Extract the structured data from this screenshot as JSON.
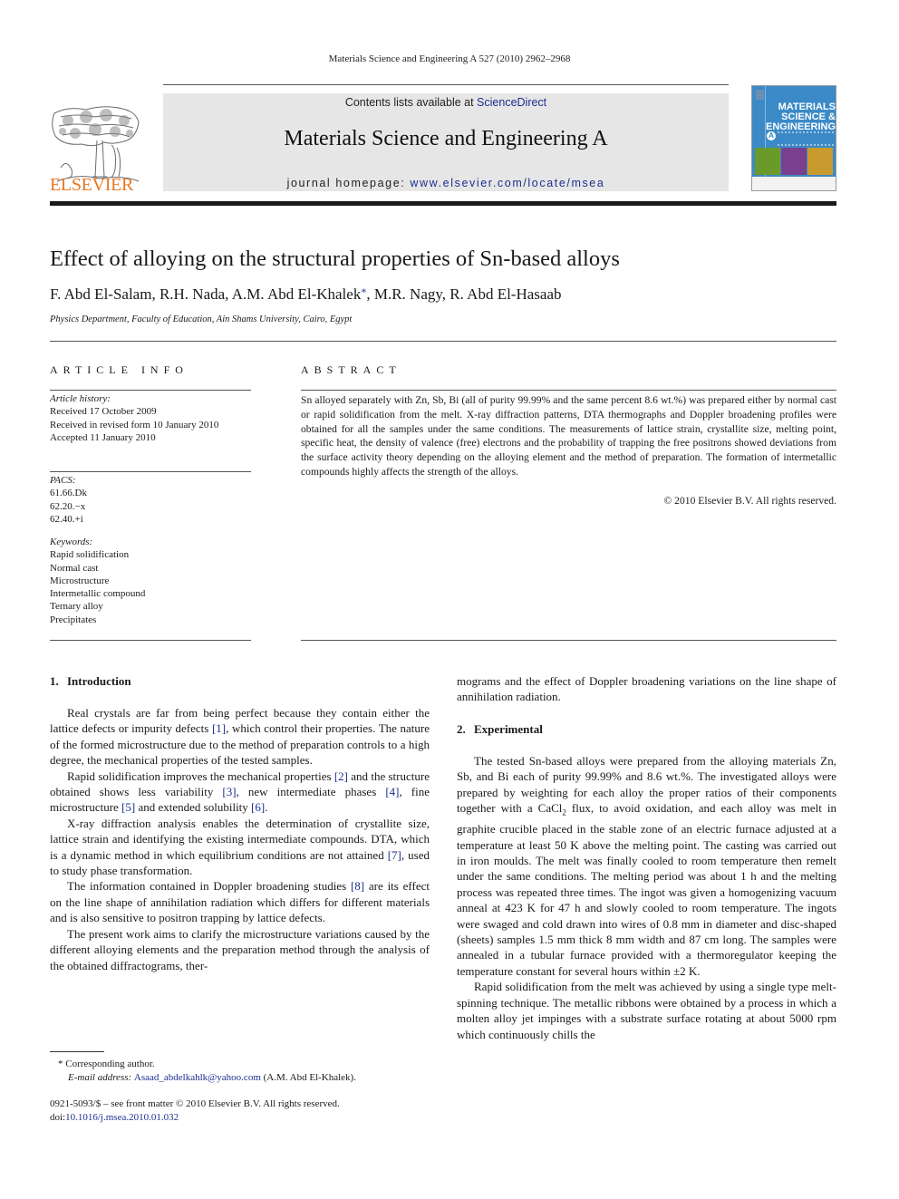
{
  "header": {
    "running_head": "Materials Science and Engineering A 527 (2010) 2962–2968",
    "contents_prefix": "Contents lists available at ",
    "contents_link": "ScienceDirect",
    "journal_name": "Materials Science and Engineering A",
    "homepage_prefix": "journal homepage: ",
    "homepage_link": "www.elsevier.com/locate/msea",
    "publisher_logo_text": "ELSEVIER",
    "cover": {
      "title_lines": [
        "MATERIALS",
        "SCIENCE &",
        "ENGINEERING"
      ],
      "badge": "A"
    },
    "colors": {
      "link": "#1c2f8f",
      "elsevier_orange": "#e87722",
      "cover_blue": "#3b8ac7"
    }
  },
  "article": {
    "title": "Effect of alloying on the structural properties of Sn-based alloys",
    "authors_before_star": "F. Abd El-Salam, R.H. Nada, A.M. Abd El-Khalek",
    "star": "*",
    "authors_after_star": ", M.R. Nagy, R. Abd El-Hasaab",
    "affiliation": "Physics Department, Faculty of Education, Ain Shams University, Cairo, Egypt"
  },
  "article_info": {
    "heading": "ARTICLE INFO",
    "history_label": "Article history:",
    "history": [
      "Received 17 October 2009",
      "Received in revised form 10 January 2010",
      "Accepted 11 January 2010"
    ],
    "pacs_label": "PACS:",
    "pacs": [
      "61.66.Dk",
      "62.20.−x",
      "62.40.+i"
    ],
    "keywords_label": "Keywords:",
    "keywords": [
      "Rapid solidification",
      "Normal cast",
      "Microstructure",
      "Intermetallic compound",
      "Ternary alloy",
      "Precipitates"
    ]
  },
  "abstract": {
    "heading": "ABSTRACT",
    "text": "Sn alloyed separately with Zn, Sb, Bi (all of purity 99.99% and the same percent 8.6 wt.%) was prepared either by normal cast or rapid solidification from the melt. X-ray diffraction patterns, DTA thermographs and Doppler broadening profiles were obtained for all the samples under the same conditions. The measurements of lattice strain, crystallite size, melting point, specific heat, the density of valence (free) electrons and the probability of trapping the free positrons showed deviations from the surface activity theory depending on the alloying element and the method of preparation. The formation of intermetallic compounds highly affects the strength of the alloys.",
    "copyright": "© 2010 Elsevier B.V. All rights reserved."
  },
  "sections": {
    "intro": {
      "number": "1.",
      "title": "Introduction",
      "p1": [
        "Real crystals are far from being perfect because they contain either the lattice defects or impurity defects ",
        "[1]",
        ", which control their properties. The nature of the formed microstructure due to the method of preparation controls to a high degree, the mechanical properties of the tested samples."
      ],
      "p2": [
        "Rapid solidification improves the mechanical properties ",
        "[2]",
        " and the structure obtained shows less variability ",
        "[3]",
        ", new intermediate phases ",
        "[4]",
        ", fine microstructure ",
        "[5]",
        " and extended solubility ",
        "[6]",
        "."
      ],
      "p3": [
        "X-ray diffraction analysis enables the determination of crystallite size, lattice strain and identifying the existing intermediate compounds. DTA, which is a dynamic method in which equilibrium conditions are not attained ",
        "[7]",
        ", used to study phase transformation."
      ],
      "p4": [
        "The information contained in Doppler broadening studies ",
        "[8]",
        " are its effect on the line shape of annihilation radiation which differs for different materials and is also sensitive to positron trapping by lattice defects."
      ],
      "p5": "The present work aims to clarify the microstructure variations caused by the different alloying elements and the preparation method through the analysis of the obtained diffractograms, ther-",
      "p5_cont": "mograms and the effect of Doppler broadening variations on the line shape of annihilation radiation."
    },
    "experimental": {
      "number": "2.",
      "title": "Experimental",
      "p1_a": "The tested Sn-based alloys were prepared from the alloying materials Zn, Sb, and Bi each of purity 99.99% and 8.6 wt.%. The investigated alloys were prepared by weighting for each alloy the proper ratios of their components together with a CaCl",
      "p1_sub": "2",
      "p1_b": " flux, to avoid oxidation, and each alloy was melt in graphite crucible placed in the stable zone of an electric furnace adjusted at a temperature at least 50 K above the melting point. The casting was carried out in iron moulds. The melt was finally cooled to room temperature then remelt under the same conditions. The melting period was about 1 h and the melting process was repeated three times. The ingot was given a homogenizing vacuum anneal at 423 K for 47 h and slowly cooled to room temperature. The ingots were swaged and cold drawn into wires of 0.8 mm in diameter and disc-shaped (sheets) samples 1.5 mm thick 8 mm width and 87 cm long. The samples were annealed in a tubular furnace provided with a thermoregulator keeping the temperature constant for several hours within ±2 K.",
      "p2": "Rapid solidification from the melt was achieved by using a single type melt-spinning technique. The metallic ribbons were obtained by a process in which a molten alloy jet impinges with a substrate surface rotating at about 5000 rpm which continuously chills the"
    }
  },
  "footnotes": {
    "star": "*",
    "corresponding": "Corresponding author.",
    "email_label": "E-mail address:",
    "email": "Asaad_abdelkahlk@yahoo.com",
    "email_owner": " (A.M. Abd El-Khalek).",
    "issn_line": "0921-5093/$ – see front matter © 2010 Elsevier B.V. All rights reserved.",
    "doi_prefix": "doi:",
    "doi": "10.1016/j.msea.2010.01.032"
  }
}
